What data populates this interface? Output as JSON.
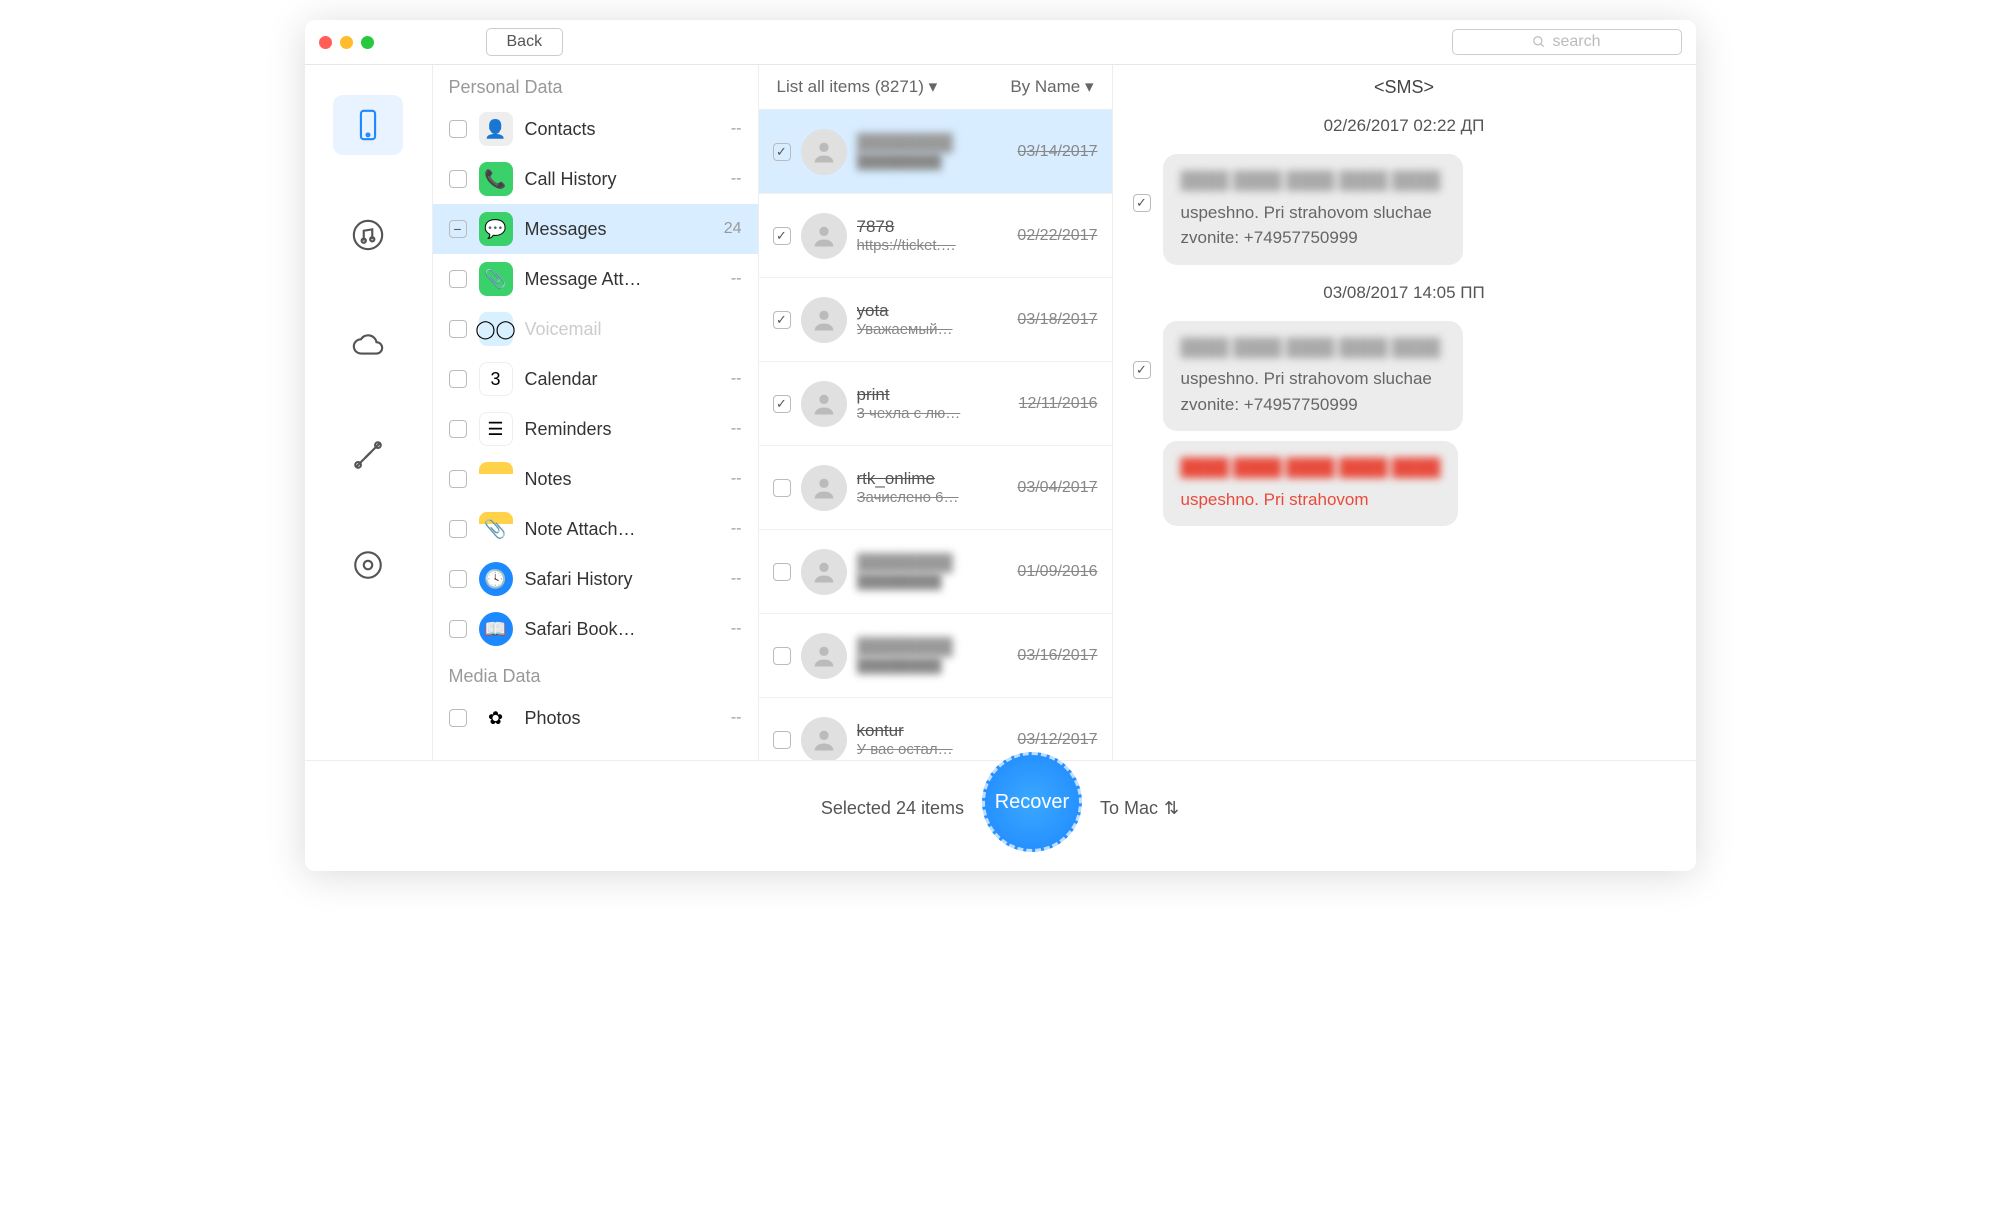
{
  "titlebar": {
    "back": "Back",
    "search_placeholder": "search"
  },
  "sections": {
    "personal": "Personal Data",
    "media": "Media Data"
  },
  "categories": [
    {
      "key": "contacts",
      "label": "Contacts",
      "count": "--",
      "icon": "ic-contacts",
      "glyph": "👤"
    },
    {
      "key": "callhistory",
      "label": "Call History",
      "count": "--",
      "icon": "ic-call",
      "glyph": "📞"
    },
    {
      "key": "messages",
      "label": "Messages",
      "count": "24",
      "icon": "ic-msg",
      "glyph": "💬",
      "selected": true,
      "chk": "minus"
    },
    {
      "key": "msgatt",
      "label": "Message Att…",
      "count": "--",
      "icon": "ic-att",
      "glyph": "📎"
    },
    {
      "key": "voicemail",
      "label": "Voicemail",
      "count": "",
      "icon": "ic-vm",
      "glyph": "◯◯",
      "disabled": true
    },
    {
      "key": "calendar",
      "label": "Calendar",
      "count": "--",
      "icon": "ic-cal",
      "glyph": "3"
    },
    {
      "key": "reminders",
      "label": "Reminders",
      "count": "--",
      "icon": "ic-rem",
      "glyph": "☰"
    },
    {
      "key": "notes",
      "label": "Notes",
      "count": "--",
      "icon": "ic-notes",
      "glyph": ""
    },
    {
      "key": "noteatt",
      "label": "Note Attach…",
      "count": "--",
      "icon": "ic-noteatt",
      "glyph": "📎"
    },
    {
      "key": "safarihist",
      "label": "Safari History",
      "count": "--",
      "icon": "ic-safh",
      "glyph": "🕓"
    },
    {
      "key": "safaribook",
      "label": "Safari Book…",
      "count": "--",
      "icon": "ic-safb",
      "glyph": "📖"
    }
  ],
  "media_categories": [
    {
      "key": "photos",
      "label": "Photos",
      "count": "--",
      "icon": "ic-photos",
      "glyph": "✿"
    }
  ],
  "threads_header": {
    "filter": "List all items (8271) ▾",
    "sort": "By Name ▾"
  },
  "threads": [
    {
      "name": "████████",
      "preview": "████████",
      "date": "03/14/2017",
      "checked": true,
      "selected": true,
      "blur": true
    },
    {
      "name": "7878",
      "preview": "https://ticket.…",
      "date": "02/22/2017",
      "checked": true
    },
    {
      "name": "yota",
      "preview": "Уважаемый…",
      "date": "03/18/2017",
      "checked": true
    },
    {
      "name": "print",
      "preview": "3 чехла с лю…",
      "date": "12/11/2016",
      "checked": true
    },
    {
      "name": "rtk_onlime",
      "preview": "Зачислено 6…",
      "date": "03/04/2017",
      "checked": false
    },
    {
      "name": "████████",
      "preview": "████████",
      "date": "01/09/2016",
      "checked": false,
      "blur": true
    },
    {
      "name": "████████",
      "preview": "████████",
      "date": "03/16/2017",
      "checked": false,
      "blur": true
    },
    {
      "name": "kontur",
      "preview": "У вас остал…",
      "date": "03/12/2017",
      "checked": false
    }
  ],
  "detail": {
    "title": "<SMS>",
    "groups": [
      {
        "stamp": "02/26/2017 02:22 ДП",
        "bubbles": [
          {
            "blurred": "████ ████ ████\n████ ████",
            "text": "uspeshno. Pri strahovom sluchae zvonite: +74957750999",
            "checked": true
          }
        ]
      },
      {
        "stamp": "03/08/2017 14:05 ПП",
        "bubbles": [
          {
            "blurred": "████ ████ ████\n████ ████",
            "text": "uspeshno. Pri strahovom sluchae zvonite: +74957750999",
            "checked": true
          },
          {
            "blurred": "████ ████ ████\n████ ████",
            "text": "uspeshno. Pri strahovom",
            "checked": false,
            "red": true,
            "nocheck": true
          }
        ]
      }
    ]
  },
  "footer": {
    "selected": "Selected 24 items",
    "recover": "Recover",
    "dest": "To Mac"
  }
}
